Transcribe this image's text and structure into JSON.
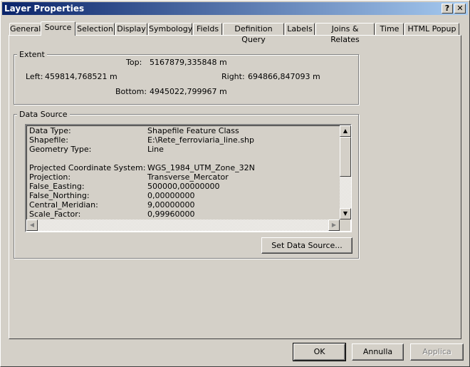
{
  "window": {
    "title": "Layer Properties",
    "help": "?",
    "close": "✕"
  },
  "tabs": [
    {
      "label": "General"
    },
    {
      "label": "Source"
    },
    {
      "label": "Selection"
    },
    {
      "label": "Display"
    },
    {
      "label": "Symbology"
    },
    {
      "label": "Fields"
    },
    {
      "label": "Definition Query"
    },
    {
      "label": "Labels"
    },
    {
      "label": "Joins & Relates"
    },
    {
      "label": "Time"
    },
    {
      "label": "HTML Popup"
    }
  ],
  "active_tab": "Source",
  "extent": {
    "title": "Extent",
    "top_label": "Top:",
    "top": "5167879,335848 m",
    "left_label": "Left:",
    "left": "459814,768521 m",
    "right_label": "Right:",
    "right": "694866,847093 m",
    "bottom_label": "Bottom:",
    "bottom": "4945022,799967 m"
  },
  "data_source": {
    "title": "Data Source",
    "rows": [
      {
        "k": "Data Type:",
        "v": "Shapefile Feature Class"
      },
      {
        "k": "Shapefile:",
        "v": "E:\\Rete_ferroviaria_line.shp"
      },
      {
        "k": "Geometry Type:",
        "v": "Line"
      },
      {
        "k": "",
        "v": ""
      },
      {
        "k": "Projected Coordinate System:",
        "v": "WGS_1984_UTM_Zone_32N"
      },
      {
        "k": "Projection:",
        "v": "Transverse_Mercator"
      },
      {
        "k": "False_Easting:",
        "v": "500000,00000000"
      },
      {
        "k": "False_Northing:",
        "v": "0,00000000"
      },
      {
        "k": "Central_Meridian:",
        "v": "9,00000000"
      },
      {
        "k": "Scale_Factor:",
        "v": "0,99960000"
      }
    ],
    "set_button": "Set Data Source..."
  },
  "buttons": {
    "ok": "OK",
    "cancel": "Annulla",
    "apply": "Applica"
  }
}
